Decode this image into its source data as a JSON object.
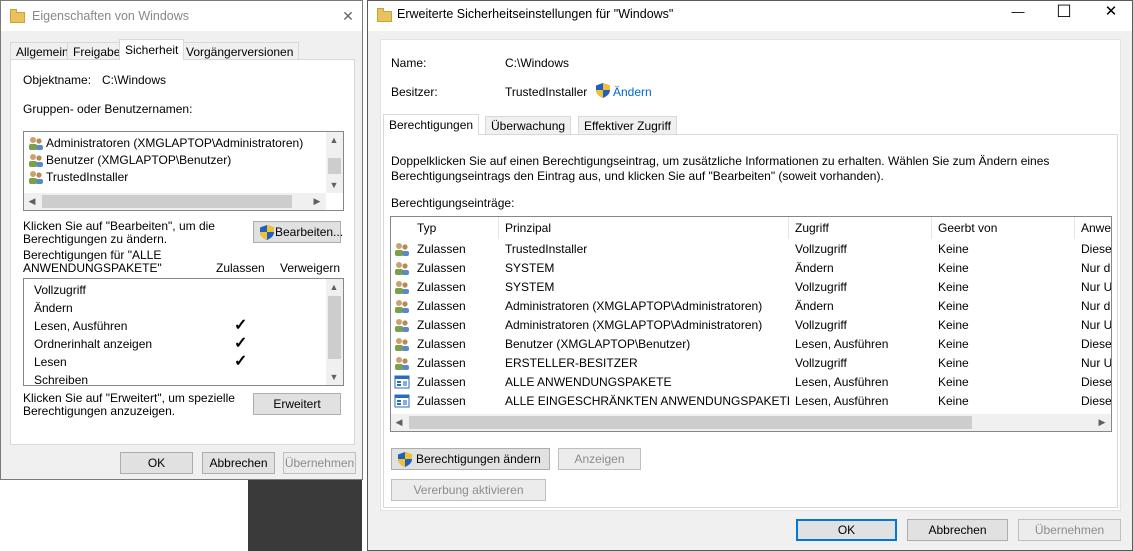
{
  "left_window": {
    "title": "Eigenschaften von Windows",
    "tabs": [
      "Allgemein",
      "Freigabe",
      "Sicherheit",
      "Vorgängerversionen"
    ],
    "object_label": "Objektname:",
    "object_value": "C:\\Windows",
    "groups_label": "Gruppen- oder Benutzernamen:",
    "groups": [
      "Administratoren (XMGLAPTOP\\Administratoren)",
      "Benutzer (XMGLAPTOP\\Benutzer)",
      "TrustedInstaller"
    ],
    "edit_hint": "Klicken Sie auf \"Bearbeiten\", um die Berechtigungen zu ändern.",
    "edit_button": "Bearbeiten...",
    "perm_for_line1": "Berechtigungen für \"ALLE",
    "perm_for_line2": "ANWENDUNGSPAKETE\"",
    "allow_label": "Zulassen",
    "deny_label": "Verweigern",
    "permissions": [
      {
        "name": "Vollzugriff",
        "allow": false
      },
      {
        "name": "Ändern",
        "allow": false
      },
      {
        "name": "Lesen, Ausführen",
        "allow": true
      },
      {
        "name": "Ordnerinhalt anzeigen",
        "allow": true
      },
      {
        "name": "Lesen",
        "allow": true
      },
      {
        "name": "Schreiben",
        "allow": false
      }
    ],
    "advanced_hint_1": "Klicken Sie auf \"Erweitert\", um spezielle",
    "advanced_hint_2": "Berechtigungen anzuzeigen.",
    "advanced_button": "Erweitert",
    "ok": "OK",
    "cancel": "Abbrechen",
    "apply": "Übernehmen"
  },
  "right_window": {
    "title": "Erweiterte Sicherheitseinstellungen für \"Windows\"",
    "name_label": "Name:",
    "name_value": "C:\\Windows",
    "owner_label": "Besitzer:",
    "owner_value": "TrustedInstaller",
    "change_link": "Ändern",
    "tabs": [
      "Berechtigungen",
      "Überwachung",
      "Effektiver Zugriff"
    ],
    "description_1": "Doppelklicken Sie auf einen Berechtigungseintrag, um zusätzliche Informationen zu erhalten. Wählen Sie zum Ändern eines",
    "description_2": "Berechtigungseintrags den Eintrag aus, und klicken Sie auf \"Bearbeiten\" (soweit vorhanden).",
    "entries_label": "Berechtigungseinträge:",
    "columns": [
      "Typ",
      "Prinzipal",
      "Zugriff",
      "Geerbt von",
      "Anwe"
    ],
    "rows": [
      {
        "icon": "user-group-icon",
        "type": "Zulassen",
        "principal": "TrustedInstaller",
        "access": "Vollzugriff",
        "inherited": "Keine",
        "applies": "Diese"
      },
      {
        "icon": "user-group-icon",
        "type": "Zulassen",
        "principal": "SYSTEM",
        "access": "Ändern",
        "inherited": "Keine",
        "applies": "Nur d"
      },
      {
        "icon": "user-group-icon",
        "type": "Zulassen",
        "principal": "SYSTEM",
        "access": "Vollzugriff",
        "inherited": "Keine",
        "applies": "Nur U"
      },
      {
        "icon": "user-group-icon",
        "type": "Zulassen",
        "principal": "Administratoren (XMGLAPTOP\\Administratoren)",
        "access": "Ändern",
        "inherited": "Keine",
        "applies": "Nur d"
      },
      {
        "icon": "user-group-icon",
        "type": "Zulassen",
        "principal": "Administratoren (XMGLAPTOP\\Administratoren)",
        "access": "Vollzugriff",
        "inherited": "Keine",
        "applies": "Nur U"
      },
      {
        "icon": "user-group-icon",
        "type": "Zulassen",
        "principal": "Benutzer (XMGLAPTOP\\Benutzer)",
        "access": "Lesen, Ausführen",
        "inherited": "Keine",
        "applies": "Diese"
      },
      {
        "icon": "user-group-icon",
        "type": "Zulassen",
        "principal": "ERSTELLER-BESITZER",
        "access": "Vollzugriff",
        "inherited": "Keine",
        "applies": "Nur U"
      },
      {
        "icon": "app-package-icon",
        "type": "Zulassen",
        "principal": "ALLE ANWENDUNGSPAKETE",
        "access": "Lesen, Ausführen",
        "inherited": "Keine",
        "applies": "Diese"
      },
      {
        "icon": "app-package-icon",
        "type": "Zulassen",
        "principal": "ALLE EINGESCHRÄNKTEN ANWENDUNGSPAKETE",
        "access": "Lesen, Ausführen",
        "inherited": "Keine",
        "applies": "Diese"
      }
    ],
    "change_permissions_button": "Berechtigungen ändern",
    "view_button": "Anzeigen",
    "enable_inheritance_button": "Vererbung aktivieren",
    "ok": "OK",
    "cancel": "Abbrechen",
    "apply": "Übernehmen",
    "minimize": "—",
    "maximize": "☐",
    "close": "✕"
  },
  "left_close": "✕"
}
